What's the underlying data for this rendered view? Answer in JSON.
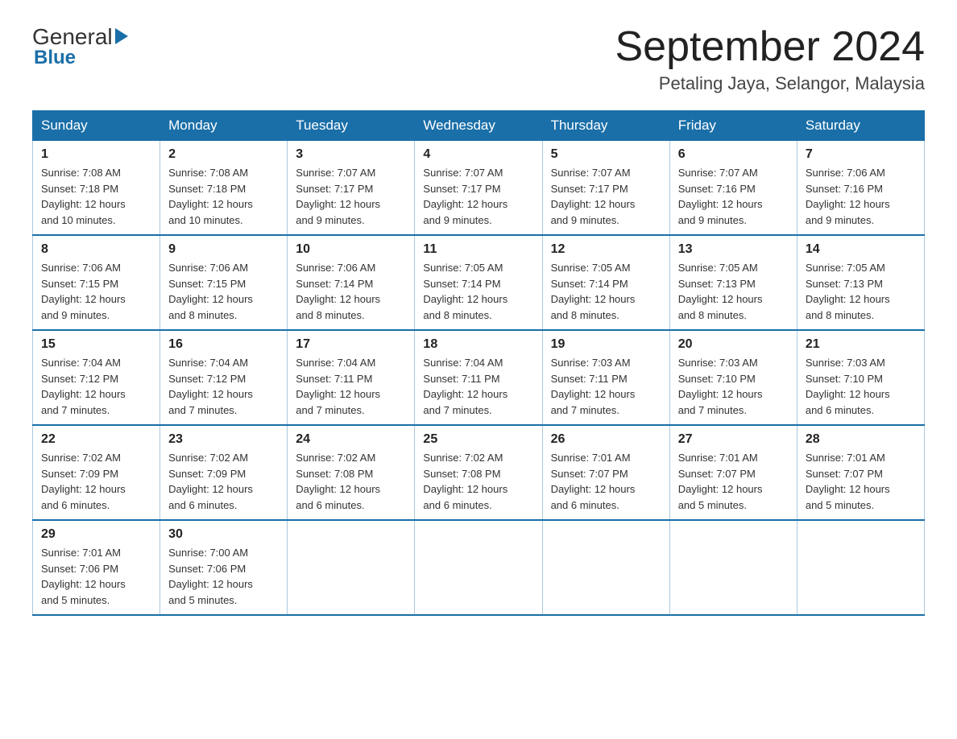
{
  "header": {
    "logo_general": "General",
    "logo_blue": "Blue",
    "month_year": "September 2024",
    "location": "Petaling Jaya, Selangor, Malaysia"
  },
  "days_of_week": [
    "Sunday",
    "Monday",
    "Tuesday",
    "Wednesday",
    "Thursday",
    "Friday",
    "Saturday"
  ],
  "weeks": [
    [
      {
        "day": "1",
        "sunrise": "7:08 AM",
        "sunset": "7:18 PM",
        "daylight": "12 hours and 10 minutes."
      },
      {
        "day": "2",
        "sunrise": "7:08 AM",
        "sunset": "7:18 PM",
        "daylight": "12 hours and 10 minutes."
      },
      {
        "day": "3",
        "sunrise": "7:07 AM",
        "sunset": "7:17 PM",
        "daylight": "12 hours and 9 minutes."
      },
      {
        "day": "4",
        "sunrise": "7:07 AM",
        "sunset": "7:17 PM",
        "daylight": "12 hours and 9 minutes."
      },
      {
        "day": "5",
        "sunrise": "7:07 AM",
        "sunset": "7:17 PM",
        "daylight": "12 hours and 9 minutes."
      },
      {
        "day": "6",
        "sunrise": "7:07 AM",
        "sunset": "7:16 PM",
        "daylight": "12 hours and 9 minutes."
      },
      {
        "day": "7",
        "sunrise": "7:06 AM",
        "sunset": "7:16 PM",
        "daylight": "12 hours and 9 minutes."
      }
    ],
    [
      {
        "day": "8",
        "sunrise": "7:06 AM",
        "sunset": "7:15 PM",
        "daylight": "12 hours and 9 minutes."
      },
      {
        "day": "9",
        "sunrise": "7:06 AM",
        "sunset": "7:15 PM",
        "daylight": "12 hours and 8 minutes."
      },
      {
        "day": "10",
        "sunrise": "7:06 AM",
        "sunset": "7:14 PM",
        "daylight": "12 hours and 8 minutes."
      },
      {
        "day": "11",
        "sunrise": "7:05 AM",
        "sunset": "7:14 PM",
        "daylight": "12 hours and 8 minutes."
      },
      {
        "day": "12",
        "sunrise": "7:05 AM",
        "sunset": "7:14 PM",
        "daylight": "12 hours and 8 minutes."
      },
      {
        "day": "13",
        "sunrise": "7:05 AM",
        "sunset": "7:13 PM",
        "daylight": "12 hours and 8 minutes."
      },
      {
        "day": "14",
        "sunrise": "7:05 AM",
        "sunset": "7:13 PM",
        "daylight": "12 hours and 8 minutes."
      }
    ],
    [
      {
        "day": "15",
        "sunrise": "7:04 AM",
        "sunset": "7:12 PM",
        "daylight": "12 hours and 7 minutes."
      },
      {
        "day": "16",
        "sunrise": "7:04 AM",
        "sunset": "7:12 PM",
        "daylight": "12 hours and 7 minutes."
      },
      {
        "day": "17",
        "sunrise": "7:04 AM",
        "sunset": "7:11 PM",
        "daylight": "12 hours and 7 minutes."
      },
      {
        "day": "18",
        "sunrise": "7:04 AM",
        "sunset": "7:11 PM",
        "daylight": "12 hours and 7 minutes."
      },
      {
        "day": "19",
        "sunrise": "7:03 AM",
        "sunset": "7:11 PM",
        "daylight": "12 hours and 7 minutes."
      },
      {
        "day": "20",
        "sunrise": "7:03 AM",
        "sunset": "7:10 PM",
        "daylight": "12 hours and 7 minutes."
      },
      {
        "day": "21",
        "sunrise": "7:03 AM",
        "sunset": "7:10 PM",
        "daylight": "12 hours and 6 minutes."
      }
    ],
    [
      {
        "day": "22",
        "sunrise": "7:02 AM",
        "sunset": "7:09 PM",
        "daylight": "12 hours and 6 minutes."
      },
      {
        "day": "23",
        "sunrise": "7:02 AM",
        "sunset": "7:09 PM",
        "daylight": "12 hours and 6 minutes."
      },
      {
        "day": "24",
        "sunrise": "7:02 AM",
        "sunset": "7:08 PM",
        "daylight": "12 hours and 6 minutes."
      },
      {
        "day": "25",
        "sunrise": "7:02 AM",
        "sunset": "7:08 PM",
        "daylight": "12 hours and 6 minutes."
      },
      {
        "day": "26",
        "sunrise": "7:01 AM",
        "sunset": "7:07 PM",
        "daylight": "12 hours and 6 minutes."
      },
      {
        "day": "27",
        "sunrise": "7:01 AM",
        "sunset": "7:07 PM",
        "daylight": "12 hours and 5 minutes."
      },
      {
        "day": "28",
        "sunrise": "7:01 AM",
        "sunset": "7:07 PM",
        "daylight": "12 hours and 5 minutes."
      }
    ],
    [
      {
        "day": "29",
        "sunrise": "7:01 AM",
        "sunset": "7:06 PM",
        "daylight": "12 hours and 5 minutes."
      },
      {
        "day": "30",
        "sunrise": "7:00 AM",
        "sunset": "7:06 PM",
        "daylight": "12 hours and 5 minutes."
      },
      null,
      null,
      null,
      null,
      null
    ]
  ],
  "labels": {
    "sunrise": "Sunrise:",
    "sunset": "Sunset:",
    "daylight": "Daylight:"
  }
}
